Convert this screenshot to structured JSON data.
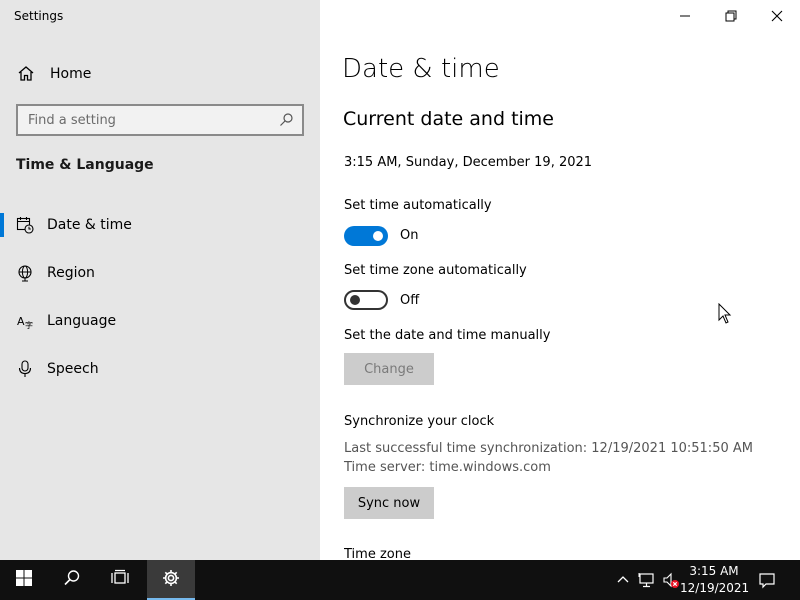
{
  "window": {
    "title": "Settings",
    "controls": [
      "minimize-icon",
      "restore-icon",
      "close-icon"
    ]
  },
  "sidebar": {
    "home_label": "Home",
    "search_placeholder": "Find a setting",
    "section_title": "Time & Language",
    "items": [
      {
        "label": "Date & time",
        "icon": "calendar-clock-icon",
        "active": true
      },
      {
        "label": "Region",
        "icon": "globe-icon",
        "active": false
      },
      {
        "label": "Language",
        "icon": "language-icon",
        "active": false
      },
      {
        "label": "Speech",
        "icon": "microphone-icon",
        "active": false
      }
    ]
  },
  "main": {
    "page_title": "Date & time",
    "section_title": "Current date and time",
    "current_datetime": "3:15 AM, Sunday, December 19, 2021",
    "auto_time": {
      "label": "Set time automatically",
      "state": "On"
    },
    "auto_timezone": {
      "label": "Set time zone automatically",
      "state": "Off"
    },
    "manual": {
      "label": "Set the date and time manually",
      "button": "Change"
    },
    "sync": {
      "title": "Synchronize your clock",
      "last_sync": "Last successful time synchronization: 12/19/2021 10:51:50 AM",
      "server": "Time server: time.windows.com",
      "button": "Sync now"
    },
    "timezone_title": "Time zone"
  },
  "taskbar": {
    "time": "3:15 AM",
    "date": "12/19/2021",
    "accent": "#76b9ed"
  },
  "colors": {
    "accent": "#0078d7",
    "sidebar_bg": "#e6e6e6",
    "taskbar_bg": "#101010"
  }
}
